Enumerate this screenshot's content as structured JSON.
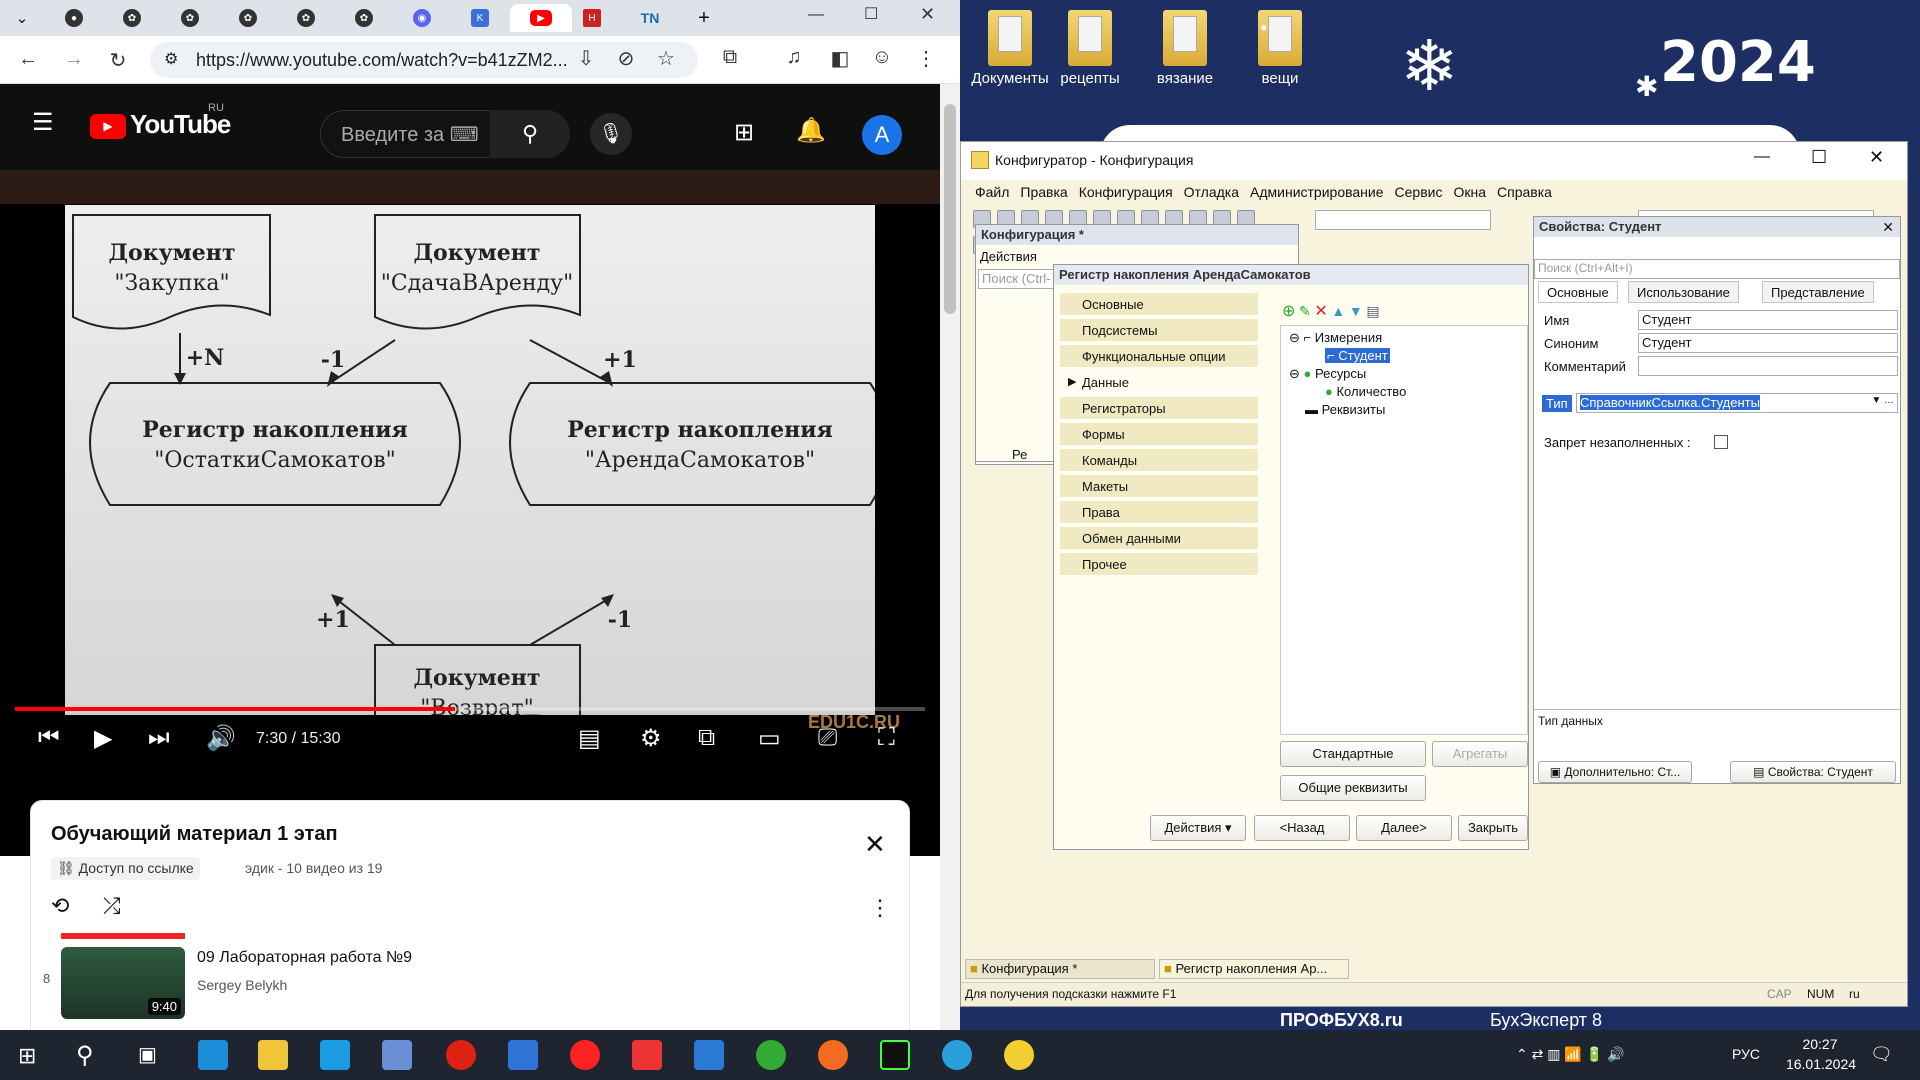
{
  "browser": {
    "url": "https://www.youtube.com/watch?v=b41zZM2...",
    "tabs": [
      {
        "icon": "github-icon"
      },
      {
        "icon": "chatgpt-icon"
      },
      {
        "icon": "chatgpt-icon"
      },
      {
        "icon": "chatgpt-icon"
      },
      {
        "icon": "chatgpt-icon"
      },
      {
        "icon": "chatgpt-icon"
      },
      {
        "icon": "discord-icon"
      },
      {
        "icon": "k-icon"
      },
      {
        "icon": "youtube-icon"
      },
      {
        "icon": "h-icon"
      },
      {
        "icon": "tn-icon",
        "label": "TN"
      }
    ],
    "new_tab": "+"
  },
  "youtube": {
    "logo": "YouTube",
    "logo_region": "RU",
    "search_placeholder": "Введите за",
    "avatar_letter": "A",
    "video_time": "7:30 / 15:30",
    "watermark": "EDU1C.RU",
    "progress_fraction": 0.484,
    "slide": {
      "doc_purchase_title": "Документ",
      "doc_purchase_name": "\"Закупка\"",
      "doc_rent_title": "Документ",
      "doc_rent_name": "\"СдачаВАренду\"",
      "reg1_title": "Регистр накопления",
      "reg1_name": "\"ОстаткиСамокатов\"",
      "reg2_title": "Регистр накопления",
      "reg2_name": "\"АрендаСамокатов\"",
      "doc_return_title": "Документ",
      "doc_return_name": "\"Возврат\"",
      "label_plusN": "+N",
      "label_minus1_a": "-1",
      "label_plus1_a": "+1",
      "label_plus1_b": "+1",
      "label_minus1_b": "-1"
    },
    "playlist": {
      "title": "Обучающий материал 1 этап",
      "access_badge": "Доступ по ссылке",
      "meta": "эдик - 10 видео из 19",
      "item_index": "8",
      "item_title": "09 Лабораторная работа №9",
      "item_author": "Sergey Belykh",
      "item_duration": "9:40"
    }
  },
  "desktop": {
    "icons": [
      "Документы",
      "рецепты",
      "вязание",
      "вещи"
    ],
    "year": "2024",
    "banner1": "ПРОФБУХ8.ru",
    "banner2": "БухЭксперт 8"
  },
  "configurator": {
    "title": "Конфигуратор - Конфигурация",
    "menu": [
      "Файл",
      "Правка",
      "Конфигурация",
      "Отладка",
      "Администрирование",
      "Сервис",
      "Окна",
      "Справка"
    ],
    "config_panel": {
      "title": "Конфигурация *",
      "actions": "Действия",
      "search": "Поиск (Ctrl-",
      "item_partial": "Ре"
    },
    "register": {
      "title": "Регистр накопления АрендаСамокатов",
      "nav": [
        "Основные",
        "Подсистемы",
        "Функциональные опции",
        "Данные",
        "Регистраторы",
        "Формы",
        "Команды",
        "Макеты",
        "Права",
        "Обмен данными",
        "Прочее"
      ],
      "nav_selected_marker": "▶",
      "tree": {
        "dimensions": "Измерения",
        "student": "Студент",
        "resources": "Ресурсы",
        "quantity": "Количество",
        "attributes": "Реквизиты"
      },
      "btn_standard": "Стандартные реквизиты",
      "btn_aggregates": "Агрегаты",
      "btn_common": "Общие реквизиты",
      "btn_actions": "Действия",
      "btn_back": "<Назад",
      "btn_next": "Далее>",
      "btn_close": "Закрыть"
    },
    "properties": {
      "title": "Свойства: Студент",
      "search": "Поиск (Ctrl+Alt+I)",
      "tabs": [
        "Основные",
        "Использование",
        "Представление"
      ],
      "name_label": "Имя",
      "name_value": "Студент",
      "synonym_label": "Синоним",
      "synonym_value": "Студент",
      "comment_label": "Комментарий",
      "comment_value": "",
      "type_label": "Тип",
      "type_value": "СправочникСсылка.Студенты",
      "forbid_label": "Запрет незаполненных :",
      "bottom_desc": "Тип данных",
      "tab_more": "Дополнительно: Ст...",
      "tab_props": "Свойства: Студент"
    },
    "window_tabs": [
      "Конфигурация *",
      "Регистр накопления Ар..."
    ],
    "status_text": "Для получения подсказки нажмите F1",
    "status_cap": "CAP",
    "status_num": "NUM",
    "status_lang": "ru"
  },
  "taskbar": {
    "lang": "РУС",
    "time": "20:27",
    "date": "16.01.2024"
  }
}
